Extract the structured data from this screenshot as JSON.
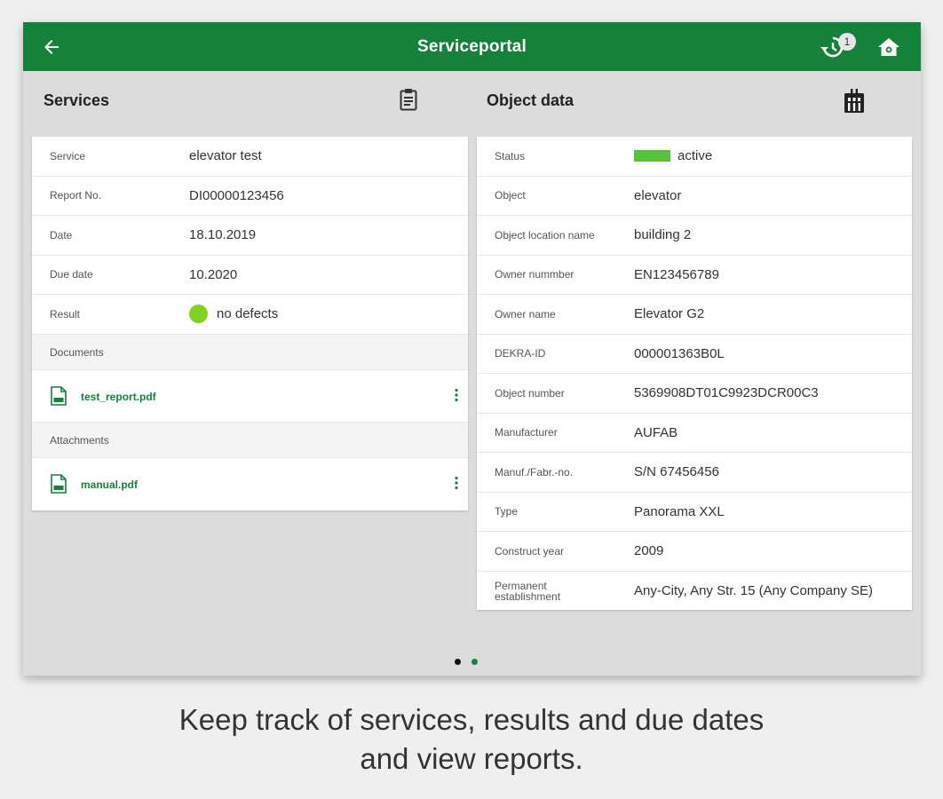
{
  "appbar": {
    "title": "Serviceportal",
    "sync_badge": "1"
  },
  "services": {
    "title": "Services",
    "rows": [
      {
        "label": "Service",
        "value": "elevator test"
      },
      {
        "label": "Report No.",
        "value": "DI00000123456"
      },
      {
        "label": "Date",
        "value": "18.10.2019"
      },
      {
        "label": "Due date",
        "value": "10.2020"
      },
      {
        "label": "Result",
        "value": "no defects"
      }
    ],
    "documents_label": "Documents",
    "documents": [
      {
        "name": "test_report.pdf"
      }
    ],
    "attachments_label": "Attachments",
    "attachments": [
      {
        "name": "manual.pdf"
      }
    ]
  },
  "object_data": {
    "title": "Object data",
    "rows": [
      {
        "label": "Status",
        "value": "active"
      },
      {
        "label": "Object",
        "value": "elevator"
      },
      {
        "label": "Object location name",
        "value": "building 2"
      },
      {
        "label": "Owner nummber",
        "value": "EN123456789"
      },
      {
        "label": "Owner name",
        "value": "Elevator G2"
      },
      {
        "label": "DEKRA-ID",
        "value": "000001363B0L"
      },
      {
        "label": "Object number",
        "value": "5369908DT01C9923DCR00C3"
      },
      {
        "label": "Manufacturer",
        "value": "AUFAB"
      },
      {
        "label": "Manuf./Fabr.-no.",
        "value": "S/N 67456456"
      },
      {
        "label": "Type",
        "value": "Panorama XXL"
      },
      {
        "label": "Construct year",
        "value": "2009"
      },
      {
        "label": "Permanent establishment",
        "value": "Any-City, Any Str. 15 (Any Company SE)"
      }
    ]
  },
  "caption": {
    "line1": "Keep track of services, results and due dates",
    "line2": "and view reports."
  },
  "colors": {
    "brand_green": "#15813b",
    "status_active": "#56c23a",
    "result_ok": "#7ed321"
  }
}
